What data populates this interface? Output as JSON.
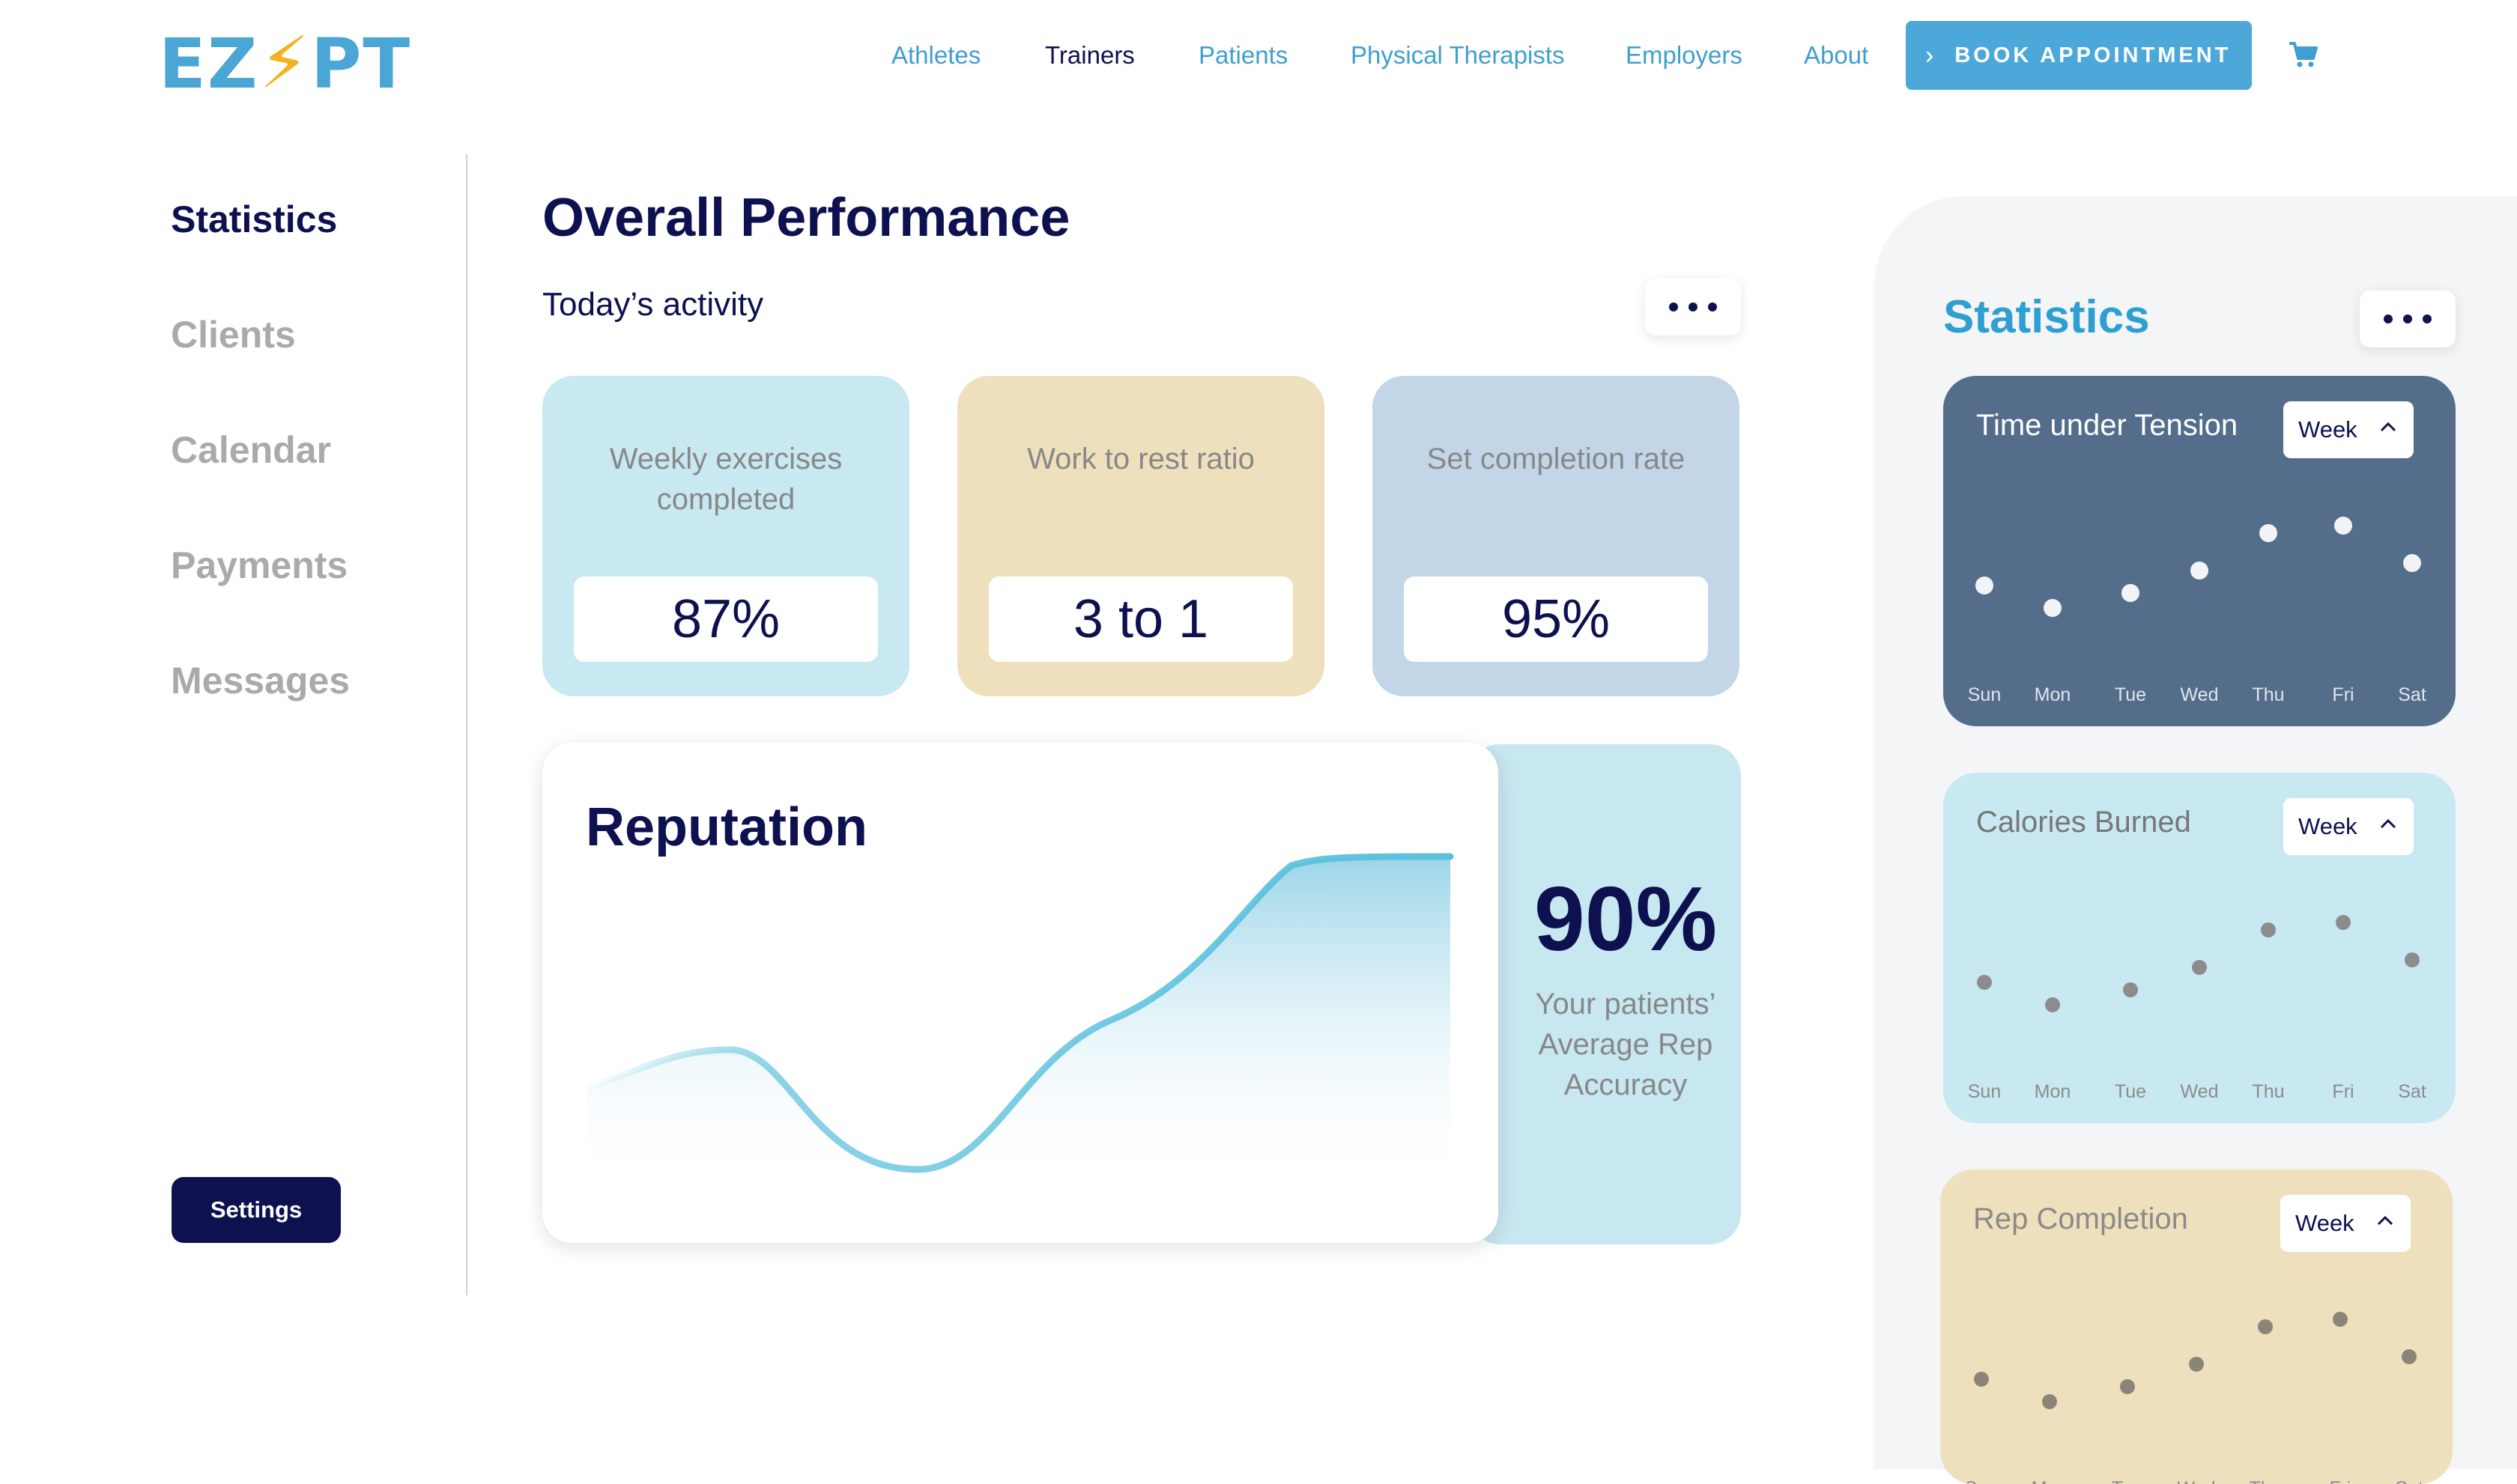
{
  "header": {
    "logo_left": "EZ",
    "logo_bolt": "⚡",
    "logo_right": "PT",
    "nav": [
      "Athletes",
      "Trainers",
      "Patients",
      "Physical Therapists",
      "Employers",
      "About"
    ],
    "active_nav": "Trainers",
    "book_label": "BOOK APPOINTMENT",
    "book_icon": "chevron-right-icon",
    "cart_icon": "cart-icon"
  },
  "sidebar": {
    "items": [
      "Statistics",
      "Clients",
      "Calendar",
      "Payments",
      "Messages"
    ],
    "active": "Statistics",
    "settings_label": "Settings"
  },
  "main": {
    "title": "Overall Performance",
    "today_label": "Today’s activity",
    "cards": [
      {
        "label": "Weekly exercises completed",
        "value": "87%",
        "color": "#c8e8f2"
      },
      {
        "label": "Work to rest ratio",
        "value": "3 to 1",
        "color": "#efe0bd"
      },
      {
        "label": "Set completion rate",
        "value": "95%",
        "color": "#c3d6e8"
      }
    ],
    "reputation": {
      "title": "Reputation",
      "percent": "90%",
      "description": "Your patients’ Average Rep Accuracy"
    }
  },
  "right_panel": {
    "title": "Statistics",
    "charts": [
      {
        "title": "Time under Tension",
        "period": "Week",
        "bg": "#546d8b",
        "title_color": "#ffffff",
        "dot_color": "#f1f3f6",
        "label_color": "#dfe5ee"
      },
      {
        "title": "Calories Burned",
        "period": "Week",
        "bg": "#c8e8f2",
        "title_color": "#777777",
        "dot_color": "#8c8c8c",
        "label_color": "#8c8c8c"
      },
      {
        "title": "Rep Completion",
        "period": "Week",
        "bg": "#efe0bd",
        "title_color": "#8a8a8a",
        "dot_color": "#8c8577",
        "label_color": "#8c8c8c"
      }
    ]
  },
  "chart_data": [
    {
      "type": "area",
      "title": "Reputation",
      "note": "curve has no printed axes or values"
    },
    {
      "type": "scatter",
      "title": "Time under Tension",
      "categories": [
        "Sun",
        "Mon",
        "Tue",
        "Wed",
        "Thu",
        "Fri",
        "Sat"
      ],
      "values": [
        3.0,
        1.5,
        2.5,
        4.0,
        6.5,
        7.0,
        4.5
      ]
    },
    {
      "type": "scatter",
      "title": "Calories Burned",
      "categories": [
        "Sun",
        "Mon",
        "Tue",
        "Wed",
        "Thu",
        "Fri",
        "Sat"
      ],
      "values": [
        3.0,
        1.5,
        2.5,
        4.0,
        6.5,
        7.0,
        4.5
      ]
    },
    {
      "type": "scatter",
      "title": "Rep Completion",
      "categories": [
        "Sun",
        "Mon",
        "Tue",
        "Wed",
        "Thu",
        "Fri",
        "Sat"
      ],
      "values": [
        3.0,
        1.5,
        2.5,
        4.0,
        6.5,
        7.0,
        4.5
      ]
    }
  ]
}
